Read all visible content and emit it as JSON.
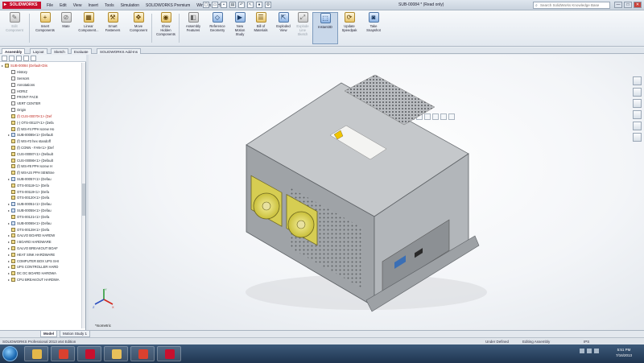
{
  "app": {
    "brand": "SOLIDWORKS",
    "document_title": "SUB-00084 * (Read only)",
    "menus": [
      "File",
      "Edit",
      "View",
      "Insert",
      "Tools",
      "Simulation",
      "SOLIDWORKS Premium",
      "Window",
      "Help"
    ],
    "search_placeholder": "Search SolidWorks Knowledge Base",
    "window_controls": [
      "—",
      "□",
      "✕"
    ]
  },
  "command_manager": {
    "items": [
      {
        "label": "Edit\nComponent",
        "icon": "edit-component-icon",
        "enabled": false
      },
      {
        "label": "Insert\nComponents",
        "icon": "insert-components-icon",
        "enabled": true
      },
      {
        "label": "Mate",
        "icon": "mate-icon",
        "enabled": true
      },
      {
        "label": "Linear\nComponent...",
        "icon": "linear-pattern-icon",
        "enabled": true
      },
      {
        "label": "Smart\nFasteners",
        "icon": "smart-fasteners-icon",
        "enabled": true
      },
      {
        "label": "Move\nComponent",
        "icon": "move-component-icon",
        "enabled": true
      },
      {
        "label": "Show\nHidden\nComponents",
        "icon": "show-hidden-icon",
        "enabled": true
      },
      {
        "label": "Assembly\nFeatures",
        "icon": "assembly-features-icon",
        "enabled": true
      },
      {
        "label": "Reference\nGeometry",
        "icon": "reference-geometry-icon",
        "enabled": true
      },
      {
        "label": "New\nMotion\nStudy",
        "icon": "motion-study-icon",
        "enabled": true
      },
      {
        "label": "Bill of\nMaterials",
        "icon": "bom-icon",
        "enabled": true
      },
      {
        "label": "Exploded\nView",
        "icon": "exploded-view-icon",
        "enabled": true
      },
      {
        "label": "Explode\nLine\nSketch",
        "icon": "explode-line-icon",
        "enabled": false
      },
      {
        "label": "Instant3D",
        "icon": "instant3d-icon",
        "enabled": true,
        "active": true
      },
      {
        "label": "Update\nSpeedpak",
        "icon": "speedpak-icon",
        "enabled": true
      },
      {
        "label": "Take\nSnapshot",
        "icon": "snapshot-icon",
        "enabled": true
      }
    ]
  },
  "tabs": [
    "Assembly",
    "Layout",
    "Sketch",
    "Evaluate",
    "SOLIDWORKS Add-Ins"
  ],
  "tree": {
    "items": [
      {
        "text": "SUB-00084 (Default<Dis",
        "kind": "root",
        "red": true
      },
      {
        "text": "History",
        "kind": "feat"
      },
      {
        "text": "Sensors",
        "kind": "feat"
      },
      {
        "text": "Annotations",
        "kind": "feat"
      },
      {
        "text": "HORIZ",
        "kind": "feat"
      },
      {
        "text": "FRONT FACE",
        "kind": "feat"
      },
      {
        "text": "VERT CENTER",
        "kind": "feat"
      },
      {
        "text": "Origin",
        "kind": "feat"
      },
      {
        "text": "(f) CUS-00070<1> (Def",
        "kind": "part",
        "red": true
      },
      {
        "text": "(-) OTS-00127<1> (Defa",
        "kind": "part"
      },
      {
        "text": "(f) WS-#4 PPH screw Ho",
        "kind": "part"
      },
      {
        "text": "SUB-00085<1> (Default",
        "kind": "sub"
      },
      {
        "text": "(f) WS-#3 hex standoff",
        "kind": "part"
      },
      {
        "text": "(f) CONN - FAN<1> (Def",
        "kind": "part"
      },
      {
        "text": "CUS-00087<1> (Default",
        "kind": "part"
      },
      {
        "text": "CUS-00086<1> (Default",
        "kind": "part"
      },
      {
        "text": "(f) WS-#8 PPH screw H",
        "kind": "part"
      },
      {
        "text": "(f) WS-US PPH SEMSne",
        "kind": "part"
      },
      {
        "text": "SUB-00057<1> (Defau",
        "kind": "sub"
      },
      {
        "text": "OTS-00118<1> (Defa",
        "kind": "part"
      },
      {
        "text": "OTS-00119<1> (Defa",
        "kind": "part"
      },
      {
        "text": "OTS-00120<1> (Defa",
        "kind": "part"
      },
      {
        "text": "SUB-00051<1> (Defau",
        "kind": "sub"
      },
      {
        "text": "SUB-00055<1> (Defau",
        "kind": "sub"
      },
      {
        "text": "OTS-00121<1> (Defa",
        "kind": "part"
      },
      {
        "text": "SUB-00065<1> (Defau",
        "kind": "sub"
      },
      {
        "text": "OTS-00128<1> (Defa",
        "kind": "part"
      },
      {
        "text": "GALVO BOARD HARDW",
        "kind": "folder"
      },
      {
        "text": "I BOARD HARDWARE",
        "kind": "folder"
      },
      {
        "text": "GALVO BREAKOUT BOAF",
        "kind": "folder"
      },
      {
        "text": "HEAT SINK HARDWARE",
        "kind": "folder"
      },
      {
        "text": "COMPUTER BOX UPS SHI",
        "kind": "folder"
      },
      {
        "text": "UPS CONTROLLER HARD",
        "kind": "folder"
      },
      {
        "text": "DC DC BOARD HARDWA",
        "kind": "folder"
      },
      {
        "text": "CPU BREAKOUT HARDWA",
        "kind": "folder"
      }
    ]
  },
  "viewport": {
    "view_label": "*Isometric",
    "triad_axes": [
      "X",
      "Y",
      "Z"
    ]
  },
  "bottom_tabs": [
    "Model",
    "Motion Study 1"
  ],
  "status": {
    "app_edition": "SOLIDWORKS Professional 2013 x64 Edition",
    "definition": "Under Defined",
    "mode": "Editing Assembly",
    "units": "IPS"
  },
  "taskbar": {
    "apps": [
      {
        "icon": "explorer-icon",
        "color": "#e4b84a"
      },
      {
        "icon": "chrome-icon",
        "color": "#d9412f"
      },
      {
        "icon": "solidworks-icon",
        "color": "#c8102e"
      },
      {
        "icon": "folder-icon",
        "color": "#e8c05a"
      },
      {
        "icon": "chrome-icon",
        "color": "#d9412f"
      },
      {
        "icon": "solidworks-icon",
        "color": "#c8102e"
      }
    ],
    "clock_time": "5:51 PM",
    "clock_date": "7/16/2013"
  },
  "colors": {
    "accent": "#c8102e",
    "taskbar": "#1f3550",
    "fan": "#e1d85c"
  }
}
